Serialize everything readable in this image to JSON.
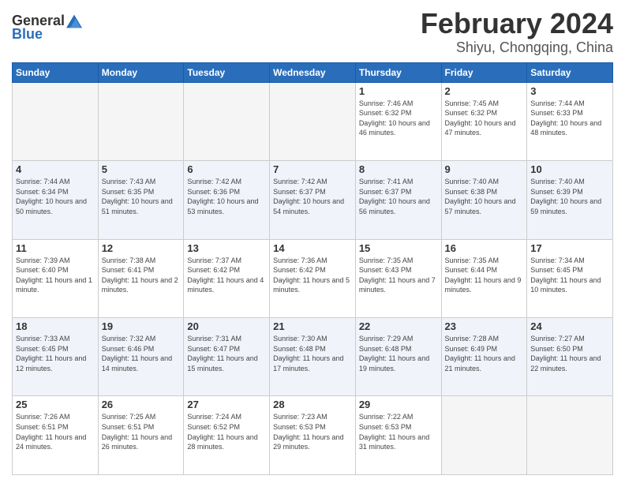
{
  "logo": {
    "general": "General",
    "blue": "Blue"
  },
  "title": "February 2024",
  "subtitle": "Shiyu, Chongqing, China",
  "weekdays": [
    "Sunday",
    "Monday",
    "Tuesday",
    "Wednesday",
    "Thursday",
    "Friday",
    "Saturday"
  ],
  "weeks": [
    [
      {
        "day": "",
        "sunrise": "",
        "sunset": "",
        "daylight": ""
      },
      {
        "day": "",
        "sunrise": "",
        "sunset": "",
        "daylight": ""
      },
      {
        "day": "",
        "sunrise": "",
        "sunset": "",
        "daylight": ""
      },
      {
        "day": "",
        "sunrise": "",
        "sunset": "",
        "daylight": ""
      },
      {
        "day": "1",
        "sunrise": "7:46 AM",
        "sunset": "6:32 PM",
        "daylight": "10 hours and 46 minutes."
      },
      {
        "day": "2",
        "sunrise": "7:45 AM",
        "sunset": "6:32 PM",
        "daylight": "10 hours and 47 minutes."
      },
      {
        "day": "3",
        "sunrise": "7:44 AM",
        "sunset": "6:33 PM",
        "daylight": "10 hours and 48 minutes."
      }
    ],
    [
      {
        "day": "4",
        "sunrise": "7:44 AM",
        "sunset": "6:34 PM",
        "daylight": "10 hours and 50 minutes."
      },
      {
        "day": "5",
        "sunrise": "7:43 AM",
        "sunset": "6:35 PM",
        "daylight": "10 hours and 51 minutes."
      },
      {
        "day": "6",
        "sunrise": "7:42 AM",
        "sunset": "6:36 PM",
        "daylight": "10 hours and 53 minutes."
      },
      {
        "day": "7",
        "sunrise": "7:42 AM",
        "sunset": "6:37 PM",
        "daylight": "10 hours and 54 minutes."
      },
      {
        "day": "8",
        "sunrise": "7:41 AM",
        "sunset": "6:37 PM",
        "daylight": "10 hours and 56 minutes."
      },
      {
        "day": "9",
        "sunrise": "7:40 AM",
        "sunset": "6:38 PM",
        "daylight": "10 hours and 57 minutes."
      },
      {
        "day": "10",
        "sunrise": "7:40 AM",
        "sunset": "6:39 PM",
        "daylight": "10 hours and 59 minutes."
      }
    ],
    [
      {
        "day": "11",
        "sunrise": "7:39 AM",
        "sunset": "6:40 PM",
        "daylight": "11 hours and 1 minute."
      },
      {
        "day": "12",
        "sunrise": "7:38 AM",
        "sunset": "6:41 PM",
        "daylight": "11 hours and 2 minutes."
      },
      {
        "day": "13",
        "sunrise": "7:37 AM",
        "sunset": "6:42 PM",
        "daylight": "11 hours and 4 minutes."
      },
      {
        "day": "14",
        "sunrise": "7:36 AM",
        "sunset": "6:42 PM",
        "daylight": "11 hours and 5 minutes."
      },
      {
        "day": "15",
        "sunrise": "7:35 AM",
        "sunset": "6:43 PM",
        "daylight": "11 hours and 7 minutes."
      },
      {
        "day": "16",
        "sunrise": "7:35 AM",
        "sunset": "6:44 PM",
        "daylight": "11 hours and 9 minutes."
      },
      {
        "day": "17",
        "sunrise": "7:34 AM",
        "sunset": "6:45 PM",
        "daylight": "11 hours and 10 minutes."
      }
    ],
    [
      {
        "day": "18",
        "sunrise": "7:33 AM",
        "sunset": "6:45 PM",
        "daylight": "11 hours and 12 minutes."
      },
      {
        "day": "19",
        "sunrise": "7:32 AM",
        "sunset": "6:46 PM",
        "daylight": "11 hours and 14 minutes."
      },
      {
        "day": "20",
        "sunrise": "7:31 AM",
        "sunset": "6:47 PM",
        "daylight": "11 hours and 15 minutes."
      },
      {
        "day": "21",
        "sunrise": "7:30 AM",
        "sunset": "6:48 PM",
        "daylight": "11 hours and 17 minutes."
      },
      {
        "day": "22",
        "sunrise": "7:29 AM",
        "sunset": "6:48 PM",
        "daylight": "11 hours and 19 minutes."
      },
      {
        "day": "23",
        "sunrise": "7:28 AM",
        "sunset": "6:49 PM",
        "daylight": "11 hours and 21 minutes."
      },
      {
        "day": "24",
        "sunrise": "7:27 AM",
        "sunset": "6:50 PM",
        "daylight": "11 hours and 22 minutes."
      }
    ],
    [
      {
        "day": "25",
        "sunrise": "7:26 AM",
        "sunset": "6:51 PM",
        "daylight": "11 hours and 24 minutes."
      },
      {
        "day": "26",
        "sunrise": "7:25 AM",
        "sunset": "6:51 PM",
        "daylight": "11 hours and 26 minutes."
      },
      {
        "day": "27",
        "sunrise": "7:24 AM",
        "sunset": "6:52 PM",
        "daylight": "11 hours and 28 minutes."
      },
      {
        "day": "28",
        "sunrise": "7:23 AM",
        "sunset": "6:53 PM",
        "daylight": "11 hours and 29 minutes."
      },
      {
        "day": "29",
        "sunrise": "7:22 AM",
        "sunset": "6:53 PM",
        "daylight": "11 hours and 31 minutes."
      },
      {
        "day": "",
        "sunrise": "",
        "sunset": "",
        "daylight": ""
      },
      {
        "day": "",
        "sunrise": "",
        "sunset": "",
        "daylight": ""
      }
    ]
  ]
}
